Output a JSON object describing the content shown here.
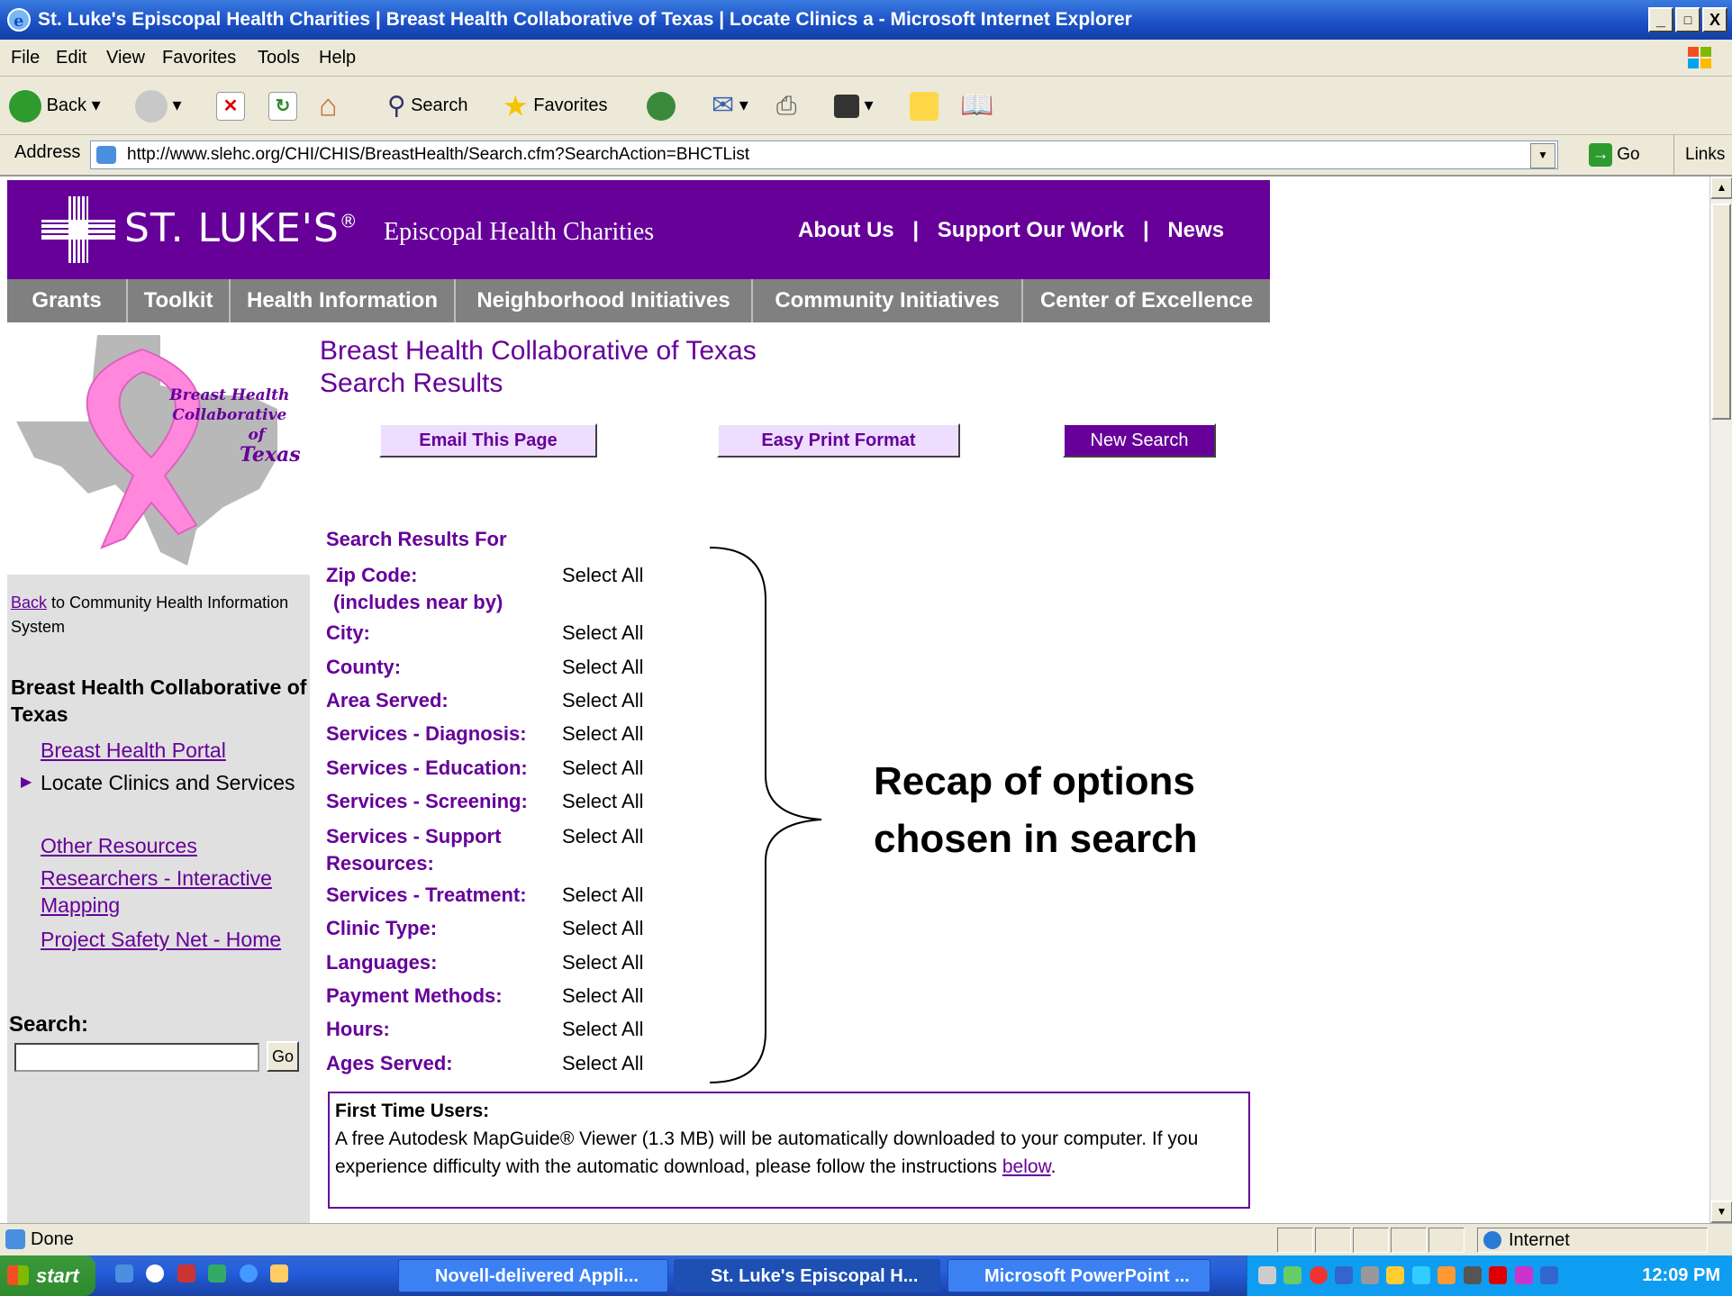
{
  "window": {
    "title": "St. Luke's Episcopal Health Charities | Breast Health Collaborative of Texas | Locate Clinics a - Microsoft Internet Explorer",
    "buttons": [
      "_",
      "□",
      "X"
    ]
  },
  "menu": [
    "File",
    "Edit",
    "View",
    "Favorites",
    "Tools",
    "Help"
  ],
  "toolbar": {
    "back": "Back",
    "search": "Search",
    "favorites": "Favorites"
  },
  "address": {
    "label": "Address",
    "url": "http://www.slehc.org/CHI/CHIS/BreastHealth/Search.cfm?SearchAction=BHCTList",
    "go": "Go",
    "links": "Links"
  },
  "header": {
    "brand": "ST. LUKE'S",
    "reg": "®",
    "sub": "Episcopal Health Charities",
    "links": [
      "About Us",
      "Support Our Work",
      "News"
    ],
    "sep": "|"
  },
  "nav": [
    "Grants",
    "Toolkit",
    "Health Information",
    "Neighborhood Initiatives",
    "Community Initiatives",
    "Center of Excellence"
  ],
  "logo_text": [
    "Breast Health",
    "Collaborative",
    "of",
    "Texas"
  ],
  "sidebar": {
    "back_link": "Back",
    "back_rest": "to Community Health Information System",
    "section_title": "Breast Health Collaborative of Texas",
    "links": [
      {
        "label": "Breast Health Portal",
        "link": true
      },
      {
        "label": "Locate Clinics and Services",
        "link": false,
        "current": true
      },
      {
        "label": "Other Resources",
        "link": true
      },
      {
        "label": "Researchers - Interactive Mapping",
        "link": true
      },
      {
        "label": "Project Safety Net - Home",
        "link": true
      }
    ],
    "search_label": "Search:",
    "search_go": "Go"
  },
  "main": {
    "title_line1": "Breast Health Collaborative of Texas",
    "title_line2": "Search Results",
    "buttons": {
      "email": "Email This Page",
      "print": "Easy Print Format",
      "new_search": "New Search"
    },
    "results_heading": "Search Results For",
    "criteria": [
      {
        "label": "Zip Code:",
        "label2": "(includes near by)",
        "value": "Select All"
      },
      {
        "label": "City:",
        "value": "Select All"
      },
      {
        "label": "County:",
        "value": "Select All"
      },
      {
        "label": "Area Served:",
        "value": "Select All"
      },
      {
        "label": "Services - Diagnosis:",
        "value": "Select All"
      },
      {
        "label": "Services - Education:",
        "value": "Select All"
      },
      {
        "label": "Services - Screening:",
        "value": "Select All"
      },
      {
        "label": "Services - Support",
        "label2": "Resources:",
        "value": "Select All"
      },
      {
        "label": "Services - Treatment:",
        "value": "Select All"
      },
      {
        "label": "Clinic Type:",
        "value": "Select All"
      },
      {
        "label": "Languages:",
        "value": "Select All"
      },
      {
        "label": "Payment Methods:",
        "value": "Select All"
      },
      {
        "label": "Hours:",
        "value": "Select All"
      },
      {
        "label": "Ages Served:",
        "value": "Select All"
      }
    ],
    "first_time": {
      "heading": "First Time Users:",
      "body": "A free Autodesk MapGuide® Viewer (1.3 MB) will be automatically downloaded to your computer. If you experience difficulty with the automatic download, please follow the instructions",
      "link": "below",
      "end": "."
    }
  },
  "annotation": {
    "line1": "Recap of options",
    "line2": "chosen in search"
  },
  "status": {
    "text": "Done",
    "zone": "Internet"
  },
  "taskbar": {
    "start": "start",
    "tasks": [
      "Novell-delivered Appli...",
      "St. Luke's Episcopal H...",
      "Microsoft PowerPoint ..."
    ],
    "clock": "12:09 PM"
  },
  "colors": {
    "brand_purple": "#660099",
    "nav_gray": "#808080",
    "xp_blue": "#245edb"
  }
}
